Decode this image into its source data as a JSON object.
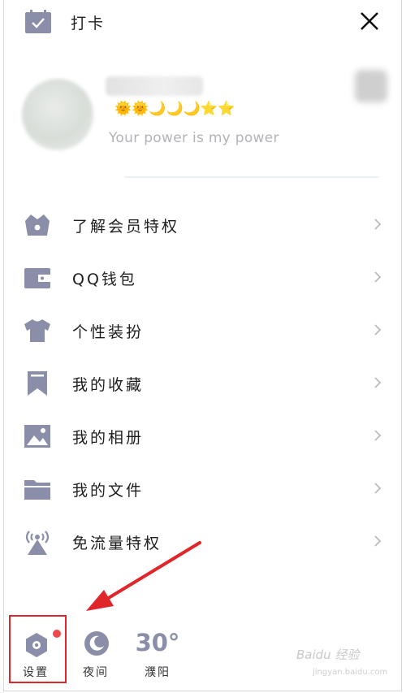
{
  "topbar": {
    "checkin_label": "打卡",
    "checkin_icon": "calendar-check-icon",
    "close_icon": "close-icon"
  },
  "profile": {
    "level_badges": "🌞🌞🌙🌙🌙⭐⭐",
    "signature": "Your power is my power"
  },
  "menu": {
    "items": [
      {
        "label": "了解会员特权",
        "icon": "crown-basket-icon"
      },
      {
        "label": "QQ钱包",
        "icon": "wallet-icon"
      },
      {
        "label": "个性装扮",
        "icon": "tshirt-icon"
      },
      {
        "label": "我的收藏",
        "icon": "bookmark-icon"
      },
      {
        "label": "我的相册",
        "icon": "photo-icon"
      },
      {
        "label": "我的文件",
        "icon": "folder-icon"
      },
      {
        "label": "免流量特权",
        "icon": "antenna-icon"
      }
    ]
  },
  "bottombar": {
    "settings_label": "设置",
    "night_label": "夜间",
    "weather_temp": "30°",
    "weather_city": "濮阳"
  },
  "watermark": {
    "brand": "Baidu 经验",
    "url": "jingyan.baidu.com"
  },
  "colors": {
    "icon_gray": "#8a8ea8",
    "highlight_red": "#e0262a",
    "badge_dot": "#f04848"
  }
}
